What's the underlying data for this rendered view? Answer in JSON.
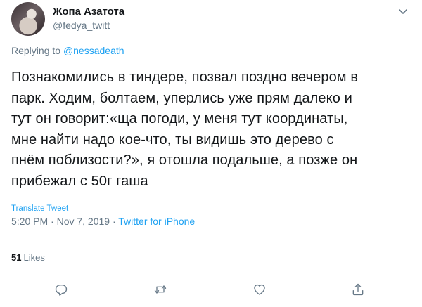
{
  "author": {
    "display_name": "Жопа Азатота",
    "handle": "@fedya_twitt"
  },
  "reply_context": {
    "prefix": "Replying to ",
    "mention": "@nessadeath"
  },
  "tweet": {
    "lines": [
      "Познакомились в тиндере, позвал поздно вечером в",
      "парк. Ходим, болтаем, уперлись уже прям далеко и",
      "тут он говорит:«ща погоди, у меня тут координаты,",
      "мне найти надо кое-что, ты видишь это дерево с",
      "пнём  поблизости?», я отошла подальше, а позже он",
      "прибежал с 50г гаша"
    ]
  },
  "translate_label": "Translate Tweet",
  "meta": {
    "timestamp": "5:20 PM · Nov 7, 2019 · ",
    "source": "Twitter for iPhone"
  },
  "stats": {
    "likes_count": "51",
    "likes_label": "Likes"
  },
  "icons": {
    "menu": "chevron-down-icon",
    "reply": "reply-icon",
    "retweet": "retweet-icon",
    "like": "heart-icon",
    "share": "share-icon"
  },
  "colors": {
    "link": "#1da1f2",
    "secondary_text": "#657786",
    "primary_text": "#14171a"
  }
}
